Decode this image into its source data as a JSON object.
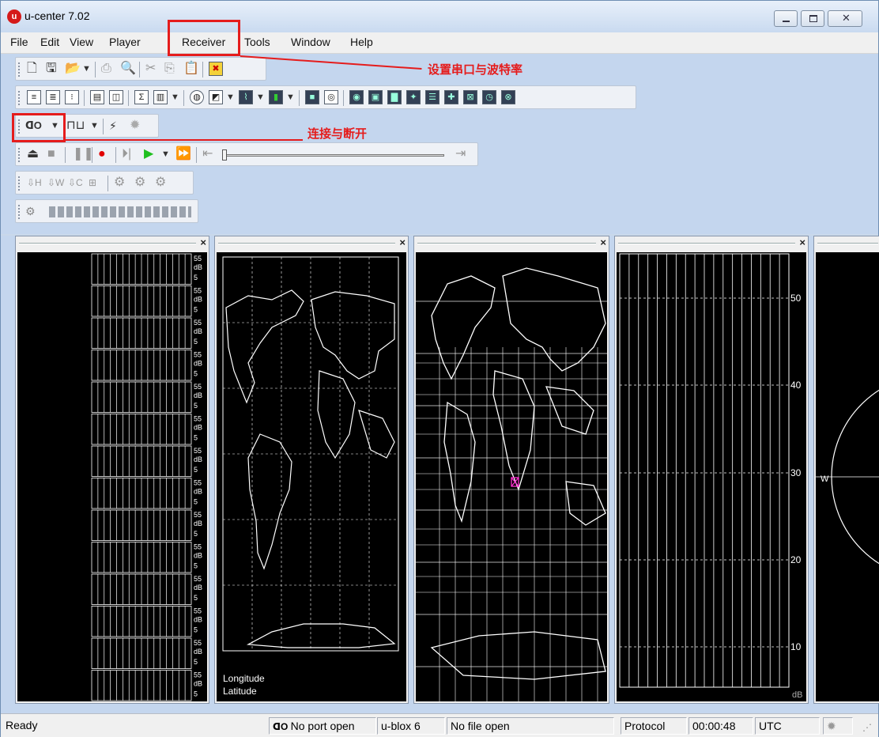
{
  "window": {
    "title": "u-center 7.02",
    "app_icon_letter": "u"
  },
  "menubar": {
    "items": [
      "File",
      "Edit",
      "View",
      "Player",
      "Receiver",
      "Tools",
      "Window",
      "Help"
    ]
  },
  "annotations": {
    "receiver_note": "设置串口与波特率",
    "connect_note": "连接与断开"
  },
  "panels": {
    "signal": {
      "bar_label_top": "55",
      "bar_label_unit": "dB",
      "bar_label_bottom": "5"
    },
    "map_left": {
      "longitude_label": "Longitude",
      "latitude_label": "Latitude"
    },
    "cn_chart": {
      "tick_labels": [
        "50",
        "40",
        "30",
        "20",
        "10"
      ],
      "unit_label": "dB"
    },
    "sky": {
      "west_label": "W"
    }
  },
  "statusbar": {
    "ready": "Ready",
    "port": "No port open",
    "receiver": "u-blox 6",
    "file": "No file open",
    "protocol": "Protocol",
    "time": "00:00:48",
    "timezone": "UTC"
  }
}
